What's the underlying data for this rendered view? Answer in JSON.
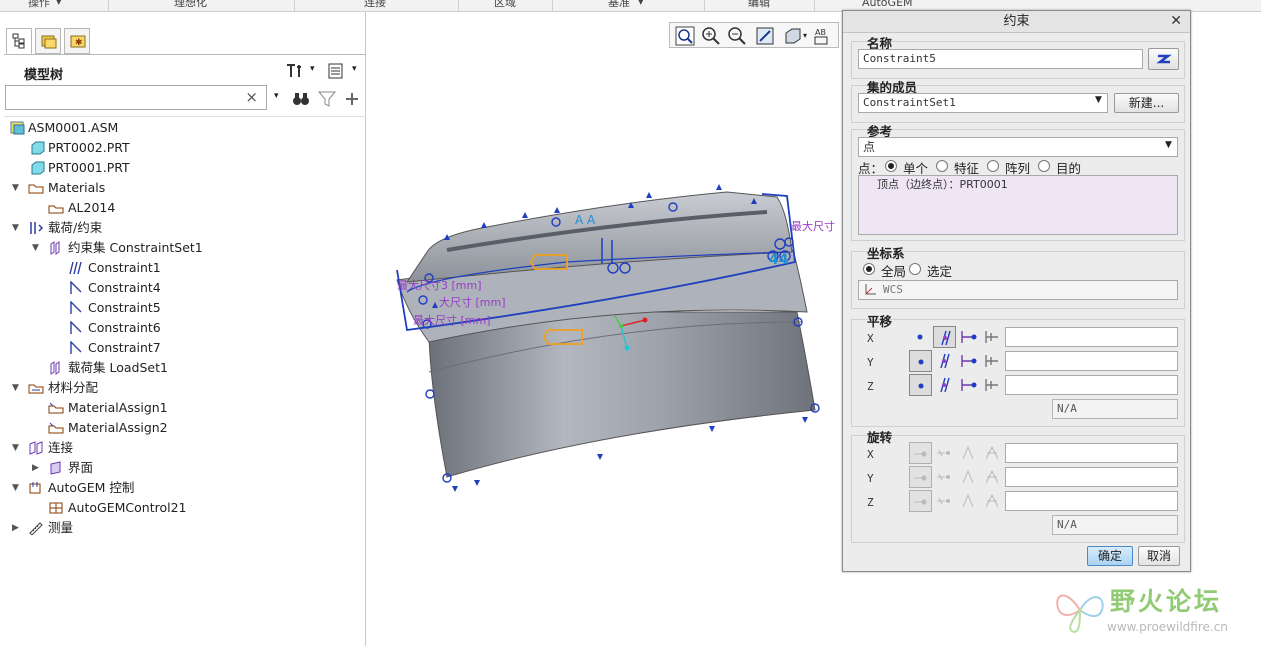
{
  "ribbon": {
    "items": [
      "操作",
      "理想化",
      "连接",
      "区域",
      "基准",
      "编辑",
      "AutoGEM"
    ]
  },
  "model_tree": {
    "title": "模型树",
    "search": {
      "value": "",
      "placeholder": ""
    },
    "nodes": [
      {
        "label": "ASM0001.ASM",
        "icon": "assembly-icon"
      },
      {
        "label": "PRT0002.PRT",
        "icon": "part-icon"
      },
      {
        "label": "PRT0001.PRT",
        "icon": "part-icon"
      },
      {
        "label": "Materials",
        "icon": "materials-folder-icon"
      },
      {
        "label": "AL2014",
        "icon": "material-icon"
      },
      {
        "label": "载荷/约束",
        "icon": "loads-constraints-icon"
      },
      {
        "label": "约束集 ConstraintSet1",
        "icon": "constraint-set-icon"
      },
      {
        "label": "Constraint1",
        "icon": "constraint-icon"
      },
      {
        "label": "Constraint4",
        "icon": "constraint-icon"
      },
      {
        "label": "Constraint5",
        "icon": "constraint-icon"
      },
      {
        "label": "Constraint6",
        "icon": "constraint-icon"
      },
      {
        "label": "Constraint7",
        "icon": "constraint-icon"
      },
      {
        "label": "载荷集 LoadSet1",
        "icon": "load-set-icon"
      },
      {
        "label": "材料分配",
        "icon": "material-assign-folder-icon"
      },
      {
        "label": "MaterialAssign1",
        "icon": "material-assign-icon"
      },
      {
        "label": "MaterialAssign2",
        "icon": "material-assign-icon"
      },
      {
        "label": "连接",
        "icon": "connection-icon"
      },
      {
        "label": "界面",
        "icon": "interface-icon"
      },
      {
        "label": "AutoGEM 控制",
        "icon": "autogem-control-icon"
      },
      {
        "label": "AutoGEMControl21",
        "icon": "autogem-item-icon"
      },
      {
        "label": "测量",
        "icon": "measure-icon"
      }
    ]
  },
  "viewport": {
    "labels": [
      "最大尺寸3 [mm]",
      "大尺寸 [mm]",
      "最大尺寸 [mm]",
      "最大尺寸"
    ]
  },
  "dialog": {
    "title": "约束",
    "name_section": {
      "title": "名称",
      "value": "Constraint5"
    },
    "set_section": {
      "title": "集的成员",
      "value": "ConstraintSet1",
      "new_button": "新建..."
    },
    "ref_section": {
      "title": "参考",
      "type": "点",
      "point_label": "点：",
      "options": [
        "单个",
        "特征",
        "阵列",
        "目的"
      ],
      "selected": "单个",
      "selection": "顶点（边终点）：PRT0001"
    },
    "csys_section": {
      "title": "坐标系",
      "options": [
        "全局",
        "选定"
      ],
      "selected": "全局",
      "value": "WCS"
    },
    "translation_section": {
      "title": "平移",
      "axes": [
        "X",
        "Y",
        "Z"
      ],
      "na": "N/A"
    },
    "rotation_section": {
      "title": "旋转",
      "axes": [
        "X",
        "Y",
        "Z"
      ],
      "na": "N/A"
    },
    "ok": "确定",
    "cancel": "取消"
  },
  "watermark": {
    "title": "野火论坛",
    "url": "www.proewildfire.cn"
  },
  "colors": {
    "accent_blue": "#1f3fbf",
    "model_gray": "#8a8f98",
    "dialog_bg": "#ececec",
    "watermark_green": "#7ec25c"
  }
}
